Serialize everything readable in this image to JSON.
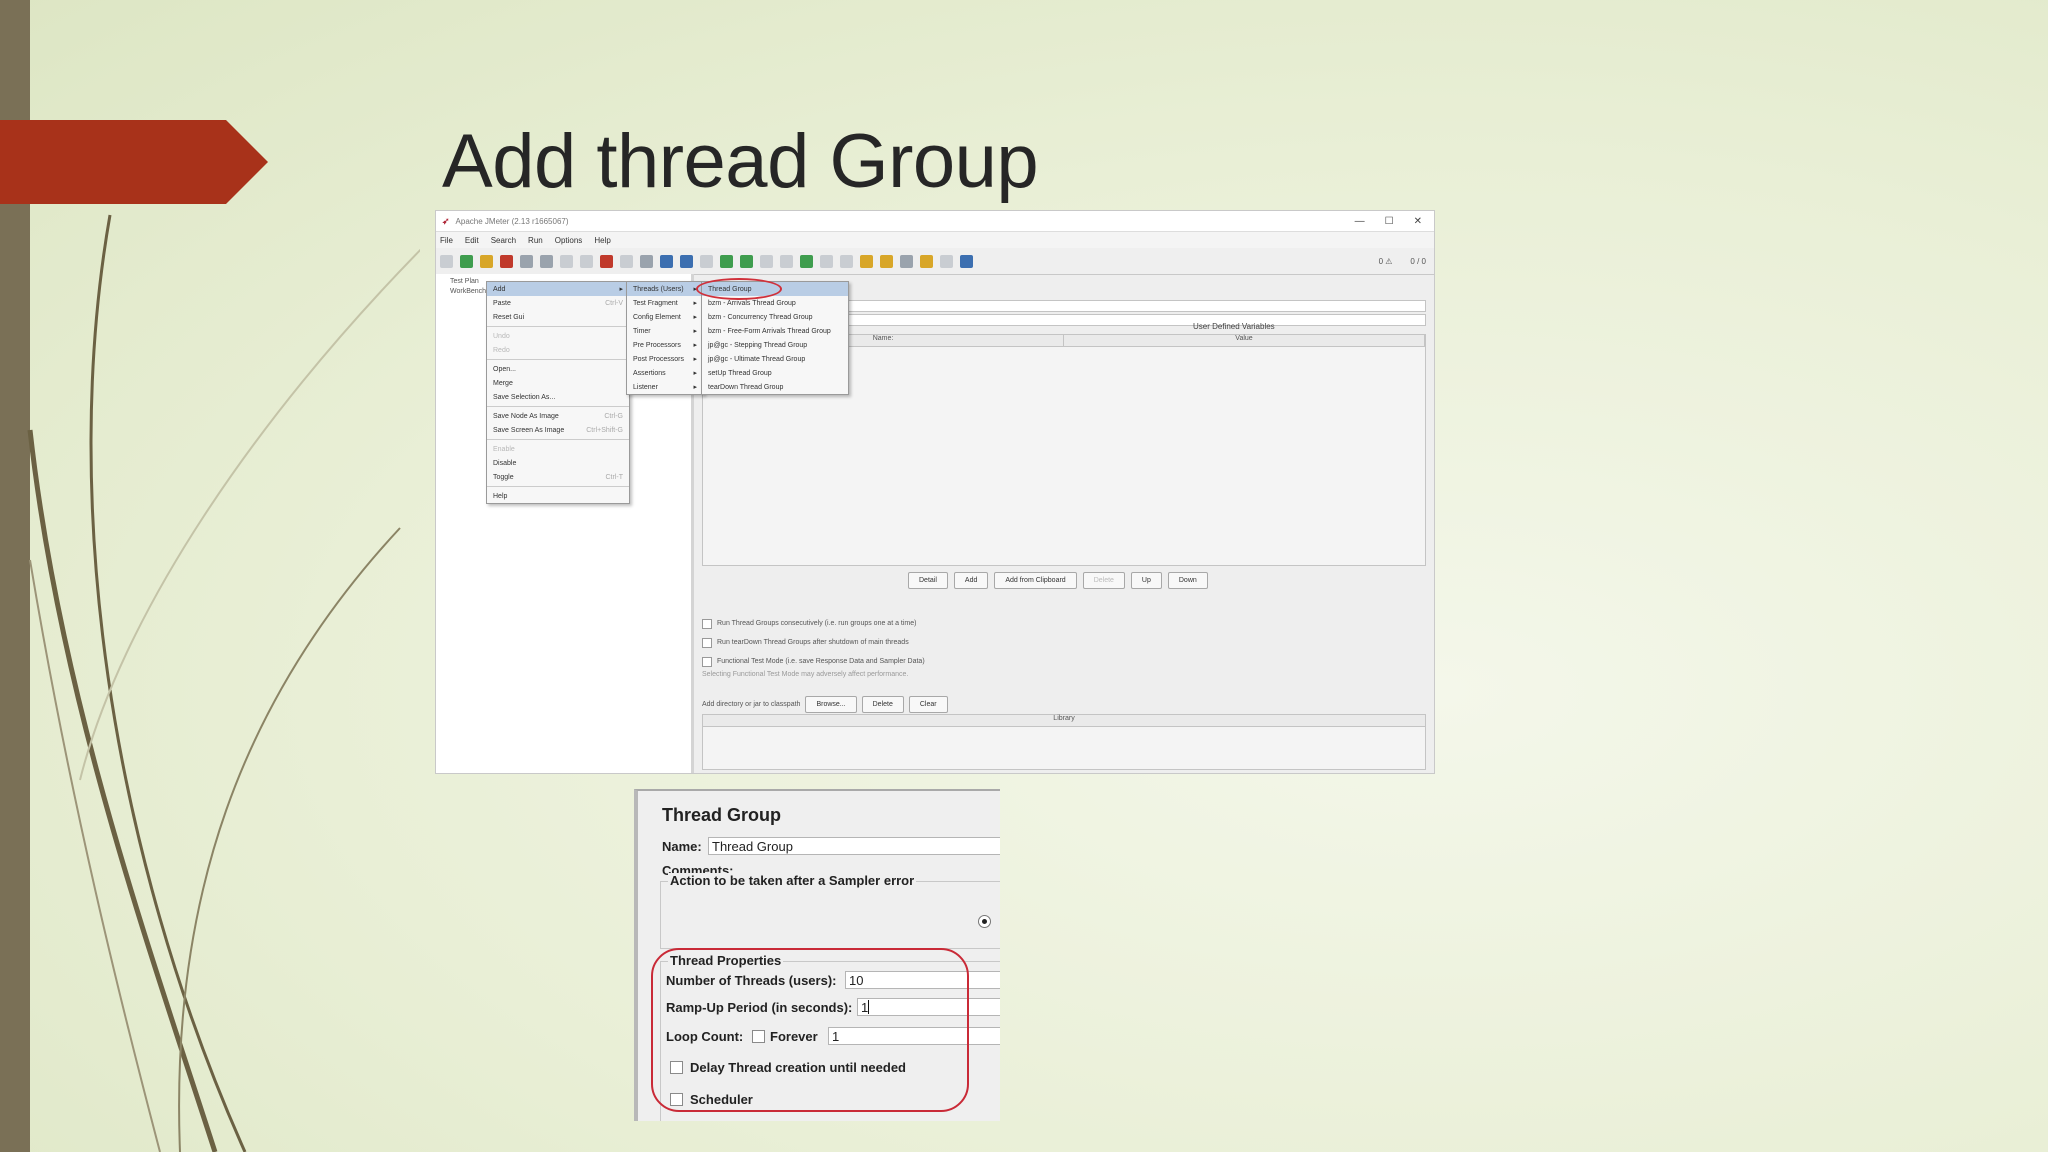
{
  "slide": {
    "title": "Add thread Group",
    "accent_color": "#a8321a",
    "left_bar_color": "#7a7056"
  },
  "jmeter": {
    "window_title": "Apache JMeter (2.13 r1665067)",
    "window_controls": [
      "—",
      "☐",
      "✕"
    ],
    "menu": [
      "File",
      "Edit",
      "Search",
      "Run",
      "Options",
      "Help"
    ],
    "toolbar_status": [
      "0 ⚠",
      "0 / 0"
    ],
    "tree": [
      "Test Plan",
      "WorkBench"
    ],
    "user_defined_variables": "User Defined Variables",
    "table_headers": [
      "Name:",
      "Value"
    ],
    "buttons": [
      "Detail",
      "Add",
      "Add from Clipboard",
      "Delete",
      "Up",
      "Down"
    ],
    "options": [
      "Run Thread Groups consecutively (i.e. run groups one at a time)",
      "Run tearDown Thread Groups after shutdown of main threads",
      "Functional Test Mode (i.e. save Response Data and Sampler Data)"
    ],
    "functional_note": "Selecting Functional Test Mode may adversely affect performance.",
    "classpath_label": "Add directory or jar to classpath",
    "classpath_buttons": [
      "Browse...",
      "Delete",
      "Clear"
    ],
    "library_header": "Library",
    "context_menu": [
      {
        "label": "Add",
        "submenu": true,
        "selected": true
      },
      {
        "label": "Paste",
        "shortcut": "Ctrl-V"
      },
      {
        "label": "Reset Gui"
      },
      {
        "sep": true
      },
      {
        "label": "Undo",
        "disabled": true
      },
      {
        "label": "Redo",
        "disabled": true
      },
      {
        "sep": true
      },
      {
        "label": "Open..."
      },
      {
        "label": "Merge"
      },
      {
        "label": "Save Selection As..."
      },
      {
        "sep": true
      },
      {
        "label": "Save Node As Image",
        "shortcut": "Ctrl-G"
      },
      {
        "label": "Save Screen As Image",
        "shortcut": "Ctrl+Shift-G"
      },
      {
        "sep": true
      },
      {
        "label": "Enable",
        "disabled": true
      },
      {
        "label": "Disable"
      },
      {
        "label": "Toggle",
        "shortcut": "Ctrl-T"
      },
      {
        "sep": true
      },
      {
        "label": "Help"
      }
    ],
    "add_submenu": [
      {
        "label": "Threads (Users)",
        "submenu": true,
        "selected": true
      },
      {
        "label": "Test Fragment",
        "submenu": true
      },
      {
        "label": "Config Element",
        "submenu": true
      },
      {
        "label": "Timer",
        "submenu": true
      },
      {
        "label": "Pre Processors",
        "submenu": true
      },
      {
        "label": "Post Processors",
        "submenu": true
      },
      {
        "label": "Assertions",
        "submenu": true
      },
      {
        "label": "Listener",
        "submenu": true
      }
    ],
    "threads_submenu": [
      {
        "label": "Thread Group",
        "selected": true
      },
      {
        "label": "bzm - Arrivals Thread Group"
      },
      {
        "label": "bzm - Concurrency Thread Group"
      },
      {
        "label": "bzm - Free-Form Arrivals Thread Group"
      },
      {
        "label": "jp@gc - Stepping Thread Group"
      },
      {
        "label": "jp@gc - Ultimate Thread Group"
      },
      {
        "label": "setUp Thread Group"
      },
      {
        "label": "tearDown Thread Group"
      }
    ]
  },
  "thread_group": {
    "title": "Thread Group",
    "name_label": "Name:",
    "name_value": "Thread Group",
    "comments_label": "Comments:",
    "sampler_error_legend": "Action to be taken after a Sampler error",
    "properties_legend": "Thread Properties",
    "threads_label": "Number of Threads (users):",
    "threads_value": "10",
    "rampup_label": "Ramp-Up Period (in seconds):",
    "rampup_value": "1",
    "loop_label": "Loop Count:",
    "forever_label": "Forever",
    "loop_value": "1",
    "delay_label": "Delay Thread creation until needed",
    "scheduler_label": "Scheduler",
    "highlight_color": "#c92a37"
  }
}
